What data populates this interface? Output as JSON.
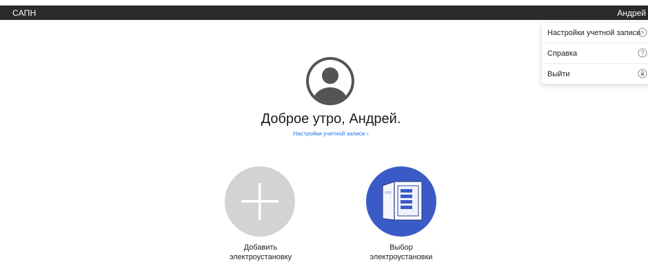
{
  "header": {
    "app_title": "САПН",
    "user_name": "Андрей"
  },
  "user_menu": {
    "items": [
      {
        "label": "Настройки учетной записи",
        "icon": "arrow-right-circle-icon"
      },
      {
        "label": "Справка",
        "icon": "help-circle-icon"
      },
      {
        "label": "Выйти",
        "icon": "lock-circle-icon"
      }
    ]
  },
  "main": {
    "greeting": "Доброе утро, Андрей.",
    "account_link": "Настройки учетной записи ›",
    "tiles": [
      {
        "caption": "Добавить\nэлектроустановку",
        "icon": "plus-icon"
      },
      {
        "caption": "Выбор\nэлектроустановки",
        "icon": "electrical-cabinet-icon"
      }
    ]
  },
  "colors": {
    "topbar": "#2b2b2b",
    "link": "#1a73e8",
    "avatar": "#545454",
    "add_tile": "#d3d3d3",
    "select_tile": "#3a5bc7"
  }
}
